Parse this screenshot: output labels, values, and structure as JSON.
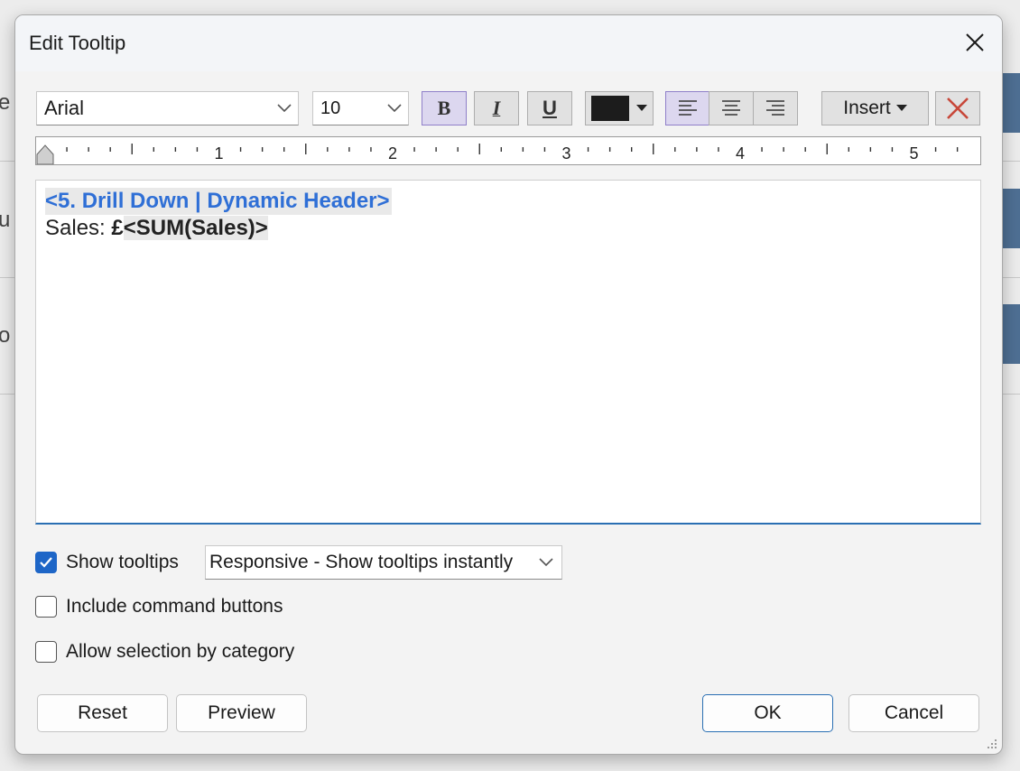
{
  "dialog": {
    "title": "Edit Tooltip"
  },
  "toolbar": {
    "font_family": "Arial",
    "font_size": "10",
    "bold_label": "B",
    "italic_label": "I",
    "underline_label": "U",
    "text_color": "#1c1c1c",
    "insert_label": "Insert"
  },
  "ruler": {
    "labels": [
      "1",
      "2",
      "3",
      "4",
      "5"
    ]
  },
  "editor": {
    "line1": "<5. Drill Down | Dynamic Header>",
    "line2_prefix": "Sales: ",
    "line2_currency": "£",
    "line2_field": "<SUM(Sales)>"
  },
  "options": {
    "show_tooltips": {
      "label": "Show tooltips",
      "checked": true
    },
    "tooltip_mode": "Responsive - Show tooltips instantly",
    "include_command_buttons": {
      "label": "Include command buttons",
      "checked": false
    },
    "allow_selection": {
      "label": "Allow selection by category",
      "checked": false
    }
  },
  "buttons": {
    "reset": "Reset",
    "preview": "Preview",
    "ok": "OK",
    "cancel": "Cancel"
  },
  "colors": {
    "accent": "#1e66c7",
    "header_text": "#2f6fd6",
    "active_toggle": "#dcd7ef"
  }
}
